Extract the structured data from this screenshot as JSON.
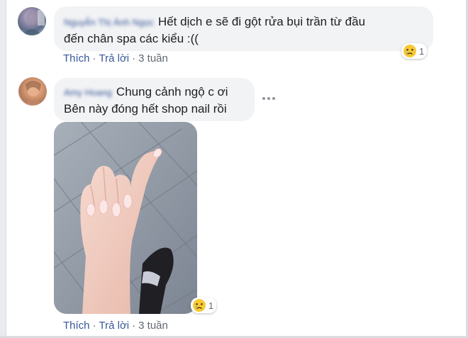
{
  "comments": [
    {
      "author": "Nguyễn Thị Ánh Ngọc",
      "text_line1": "Hết dịch e sẽ đi gột rửa bụi trần từ đầu",
      "text_line2": "đến chân spa các kiểu :((",
      "reaction_icon": "sad-crying-face-icon",
      "reaction_count": "1",
      "like_label": "Thích",
      "reply_label": "Trả lời",
      "separator": "·",
      "time": "3 tuần"
    },
    {
      "author": "Amy Hoang",
      "text_line1": "Chung cảnh ngộ c ơi",
      "text_line2": "Bên này đóng hết shop nail rồi",
      "attachment_icon": "hand-nails-photo",
      "reaction_icon": "sad-crying-face-icon",
      "reaction_count": "1",
      "like_label": "Thích",
      "reply_label": "Trả lời",
      "separator": "·",
      "time": "3 tuần"
    }
  ],
  "colors": {
    "link": "#385898",
    "bubble": "#f2f3f5",
    "meta": "#606770"
  }
}
